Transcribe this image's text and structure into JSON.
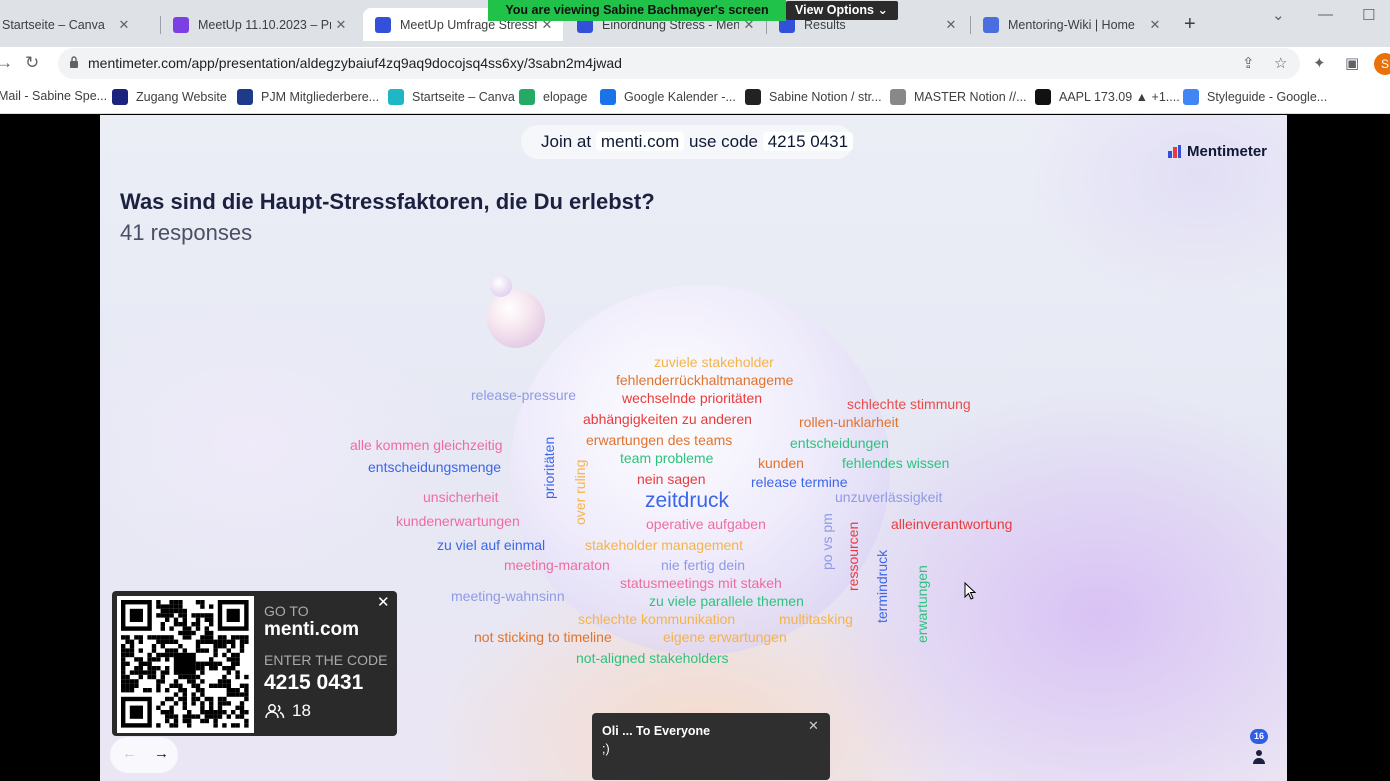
{
  "browser": {
    "tabs": [
      {
        "title": "Startseite – Canva",
        "color": "#1fb7c5"
      },
      {
        "title": "MeetUp 11.10.2023 – Präs",
        "color": "#7b3fe4"
      },
      {
        "title": "MeetUp Umfrage Stressfa",
        "color": "#3350d8"
      },
      {
        "title": "Einordnung Stress - Menti",
        "color": "#3350d8"
      },
      {
        "title": "Results",
        "color": "#3350d8"
      },
      {
        "title": "Mentoring-Wiki | Home",
        "color": "#4a6ee0"
      }
    ],
    "tab_close": "✕",
    "new_tab": "+",
    "url": "mentimeter.com/app/presentation/aldegzybaiuf4zq9aq9docojsq4ss6xy/3sabn2m4jwad",
    "bookmarks": [
      {
        "label": "Mail - Sabine Spe...",
        "color": "#c5221f"
      },
      {
        "label": "Zugang Website",
        "color": "#1a237e"
      },
      {
        "label": "PJM Mitgliederbere...",
        "color": "#1e3a8a"
      },
      {
        "label": "Startseite – Canva",
        "color": "#1fb7c5"
      },
      {
        "label": "elopage",
        "color": "#22aa66"
      },
      {
        "label": "Google Kalender -...",
        "color": "#1a73e8"
      },
      {
        "label": "Sabine Notion / str...",
        "color": "#222222"
      },
      {
        "label": "MASTER Notion //...",
        "color": "#888888"
      },
      {
        "label": "AAPL 173.09 ▲ +1....",
        "color": "#111111"
      },
      {
        "label": "Styleguide - Google...",
        "color": "#4285f4"
      }
    ],
    "profile_initial": "S"
  },
  "screen_share": {
    "banner_prefix": "You are viewing",
    "presenter": "Sabine Bachmayer's screen",
    "view_options_label": "View Options"
  },
  "slide": {
    "join_prefix": "Join at",
    "join_site": "menti.com",
    "join_mid": "use code",
    "join_code": "4215 0431",
    "brand": "Mentimeter",
    "question": "Was sind die Haupt-Stressfaktoren, die Du erlebst?",
    "responses": "41 responses",
    "wordcloud": [
      {
        "text": "zuviele stakeholder",
        "color": "#f6b347"
      },
      {
        "text": "fehlenderrückhaltmanageme",
        "color": "#e0732d"
      },
      {
        "text": "release-pressure",
        "color": "#8f9ae6"
      },
      {
        "text": "wechselnde prioritäten",
        "color": "#e83c3c"
      },
      {
        "text": "schlechte stimmung",
        "color": "#ea4c4c"
      },
      {
        "text": "abhängigkeiten zu anderen",
        "color": "#e83c3c"
      },
      {
        "text": "rollen-unklarheit",
        "color": "#e0732d"
      },
      {
        "text": "alle kommen gleichzeitig",
        "color": "#f06ca0"
      },
      {
        "text": "erwartungen des teams",
        "color": "#e0732d"
      },
      {
        "text": "entscheidungen",
        "color": "#2ec27e"
      },
      {
        "text": "prioritäten",
        "color": "#3c66e8"
      },
      {
        "text": "entscheidungsmenge",
        "color": "#3c66e8"
      },
      {
        "text": "team probleme",
        "color": "#2ec27e"
      },
      {
        "text": "kunden",
        "color": "#e0732d"
      },
      {
        "text": "fehlendes wissen",
        "color": "#2ec27e"
      },
      {
        "text": "over ruling",
        "color": "#f6b347"
      },
      {
        "text": "nein sagen",
        "color": "#e83c3c"
      },
      {
        "text": "release termine",
        "color": "#3c66e8"
      },
      {
        "text": "unsicherheit",
        "color": "#f06ca0"
      },
      {
        "text": "zeitdruck",
        "color": "#3c66e8"
      },
      {
        "text": "unzuverlässigkeit",
        "color": "#8f9ae6"
      },
      {
        "text": "kundenerwartungen",
        "color": "#f06ca0"
      },
      {
        "text": "operative aufgaben",
        "color": "#f06ca0"
      },
      {
        "text": "po vs pm",
        "color": "#8f9ae6"
      },
      {
        "text": "alleinverantwortung",
        "color": "#e83c3c"
      },
      {
        "text": "zu viel auf einmal",
        "color": "#3c66e8"
      },
      {
        "text": "stakeholder management",
        "color": "#f6b347"
      },
      {
        "text": "ressourcen",
        "color": "#e83c3c"
      },
      {
        "text": "meeting-maraton",
        "color": "#f06ca0"
      },
      {
        "text": "nie fertig dein",
        "color": "#8f9ae6"
      },
      {
        "text": "termindruck",
        "color": "#3c66e8"
      },
      {
        "text": "erwartungen",
        "color": "#2ec27e"
      },
      {
        "text": "statusmeetings mit stakeh",
        "color": "#f06ca0"
      },
      {
        "text": "meeting-wahnsinn",
        "color": "#8f9ae6"
      },
      {
        "text": "zu viele parallele themen",
        "color": "#2ec27e"
      },
      {
        "text": "schlechte kommunikation",
        "color": "#f6b347"
      },
      {
        "text": "multitasking",
        "color": "#f6b347"
      },
      {
        "text": "not sticking to timeline",
        "color": "#e0732d"
      },
      {
        "text": "eigene erwartungen",
        "color": "#f6b347"
      },
      {
        "text": "not-aligned stakeholders",
        "color": "#2ec27e"
      }
    ],
    "qr_card": {
      "goto": "GO TO",
      "site": "menti.com",
      "enter": "ENTER THE CODE",
      "code": "4215 0431",
      "participants": "18",
      "close": "✕"
    },
    "nav": {
      "prev": "←",
      "next": "→"
    },
    "participant_badge": "16"
  },
  "chat": {
    "sender": "Oli ... To Everyone",
    "message": ";)",
    "close": "✕"
  }
}
